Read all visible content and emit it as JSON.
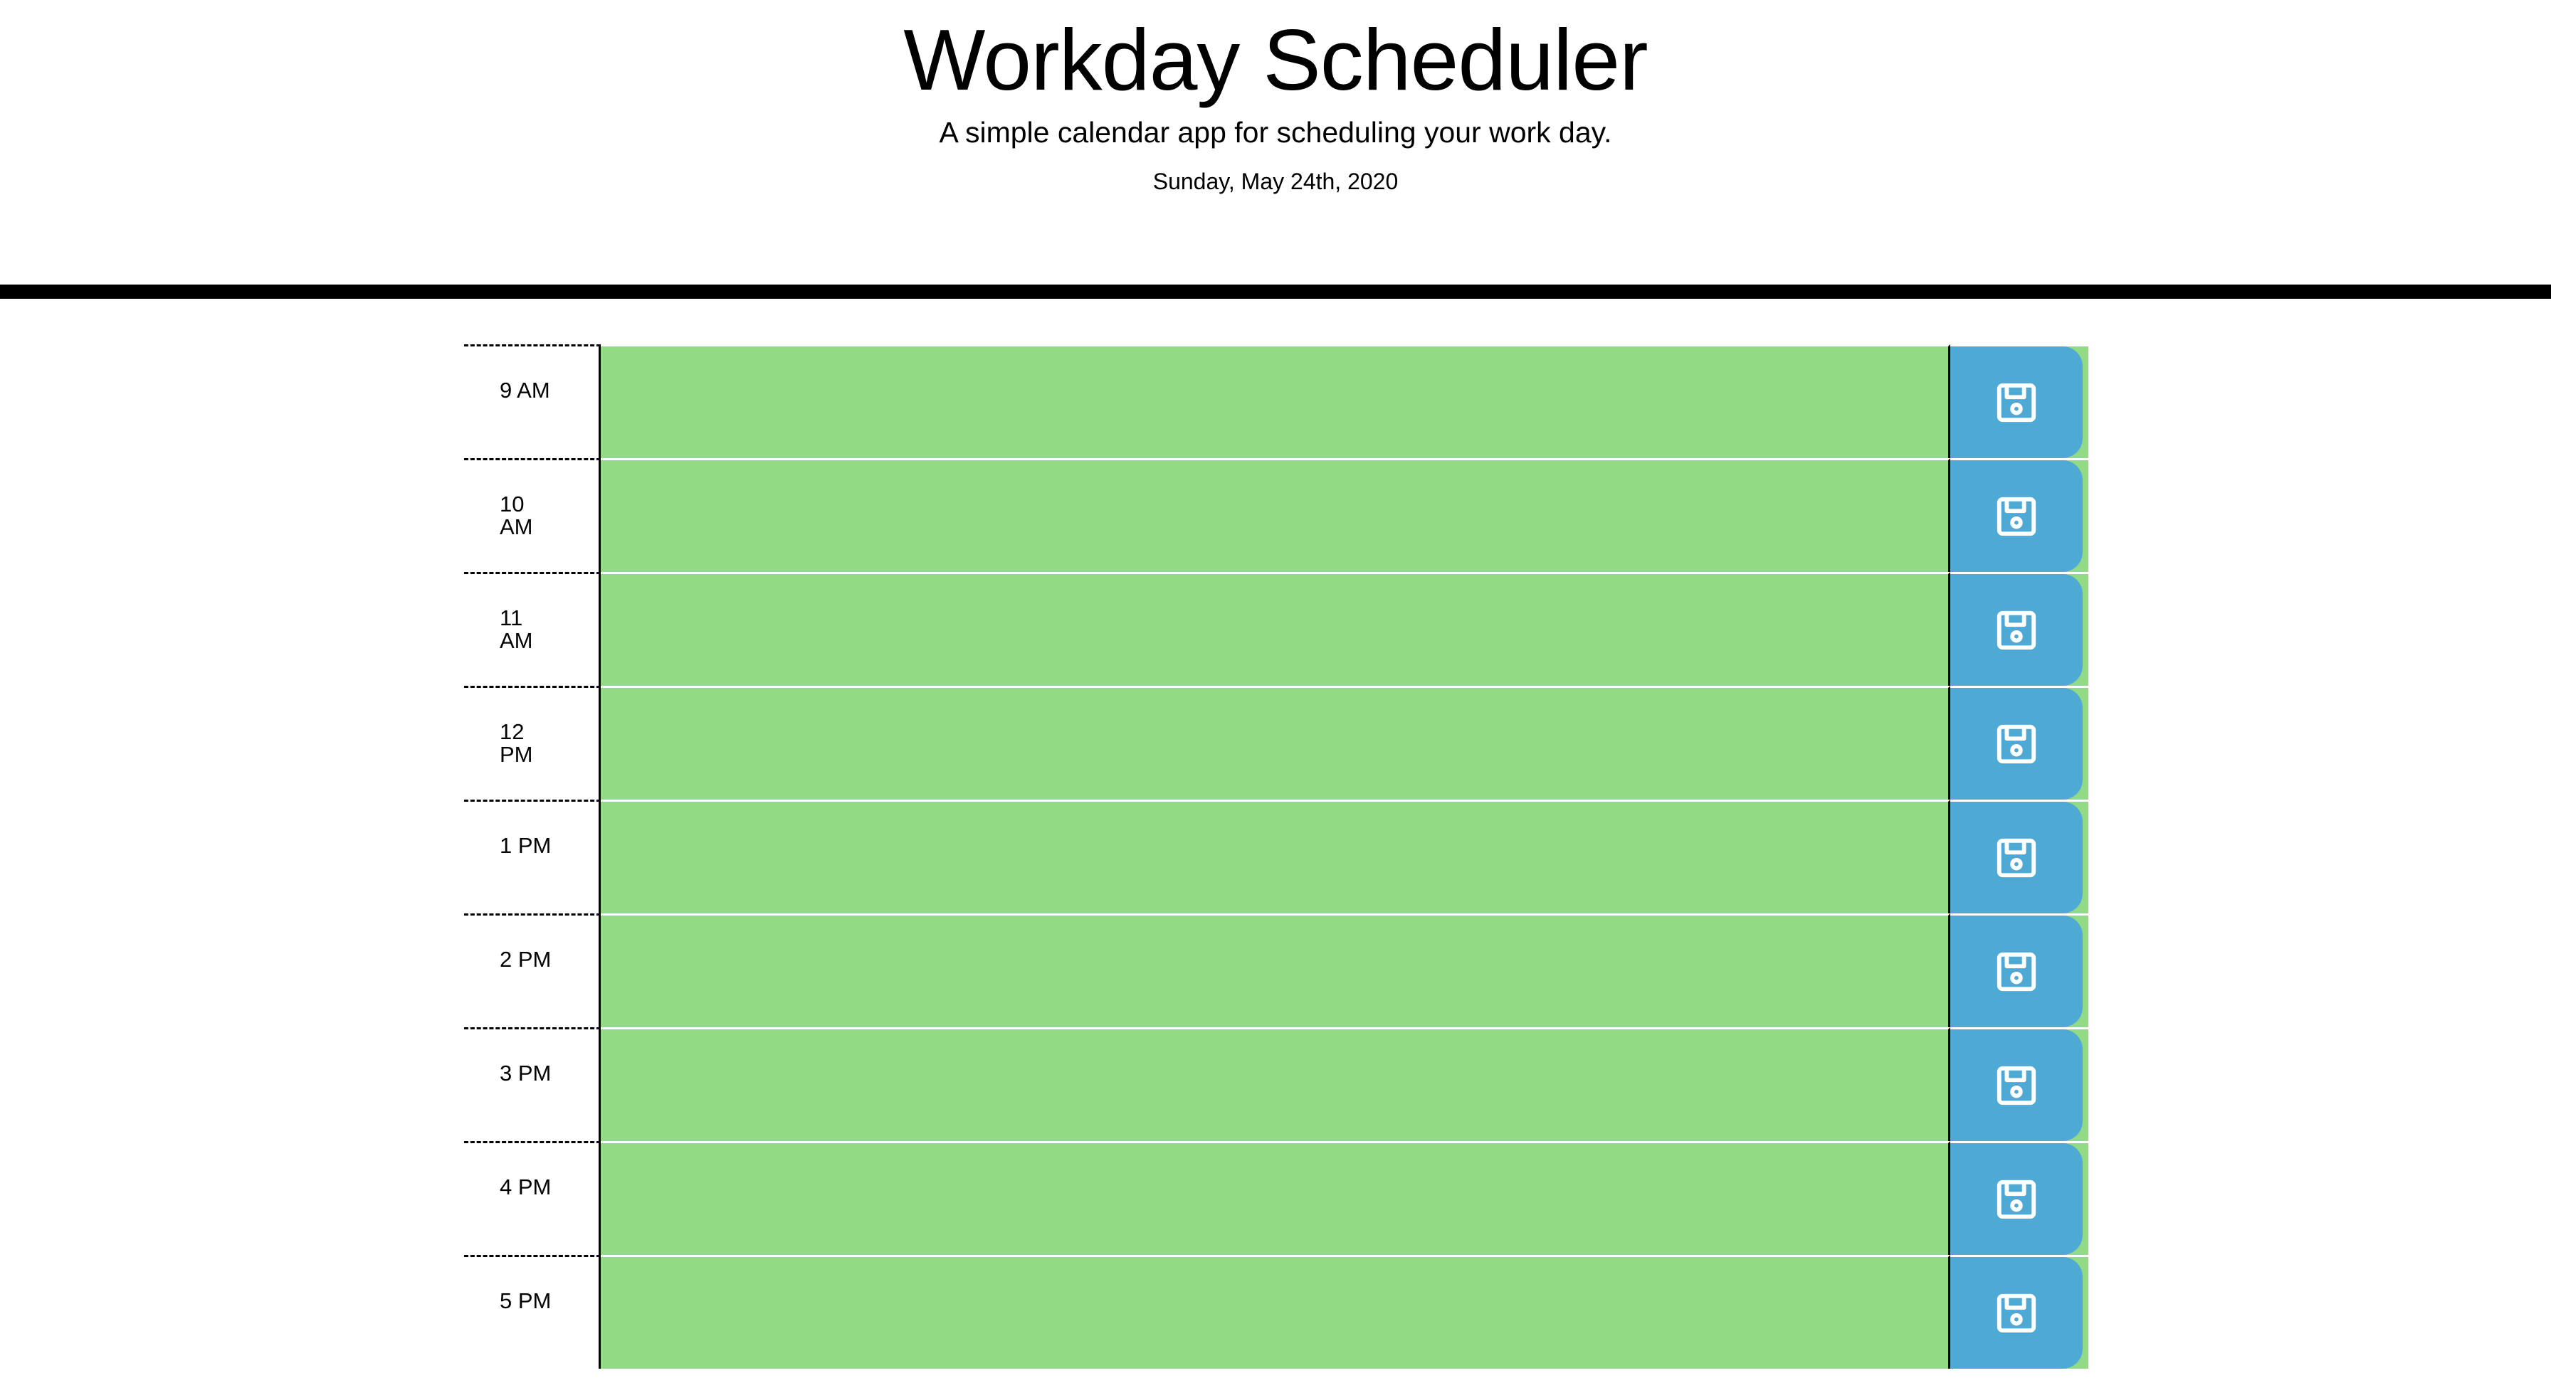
{
  "header": {
    "title": "Workday Scheduler",
    "subtitle": "A simple calendar app for scheduling your work day.",
    "current_day": "Sunday, May 24th, 2020"
  },
  "schedule": {
    "rows": [
      {
        "hour": "9 AM",
        "description": "",
        "save_icon": "save-icon"
      },
      {
        "hour": "10 AM",
        "description": "",
        "save_icon": "save-icon"
      },
      {
        "hour": "11 AM",
        "description": "",
        "save_icon": "save-icon"
      },
      {
        "hour": "12 PM",
        "description": "",
        "save_icon": "save-icon"
      },
      {
        "hour": "1 PM",
        "description": "",
        "save_icon": "save-icon"
      },
      {
        "hour": "2 PM",
        "description": "",
        "save_icon": "save-icon"
      },
      {
        "hour": "3 PM",
        "description": "",
        "save_icon": "save-icon"
      },
      {
        "hour": "4 PM",
        "description": "",
        "save_icon": "save-icon"
      },
      {
        "hour": "5 PM",
        "description": "",
        "save_icon": "save-icon"
      }
    ]
  },
  "colors": {
    "future_block": "#92da84",
    "save_button": "#4eaad5",
    "text": "#000000",
    "background": "#ffffff",
    "header_rule": "#000000"
  }
}
